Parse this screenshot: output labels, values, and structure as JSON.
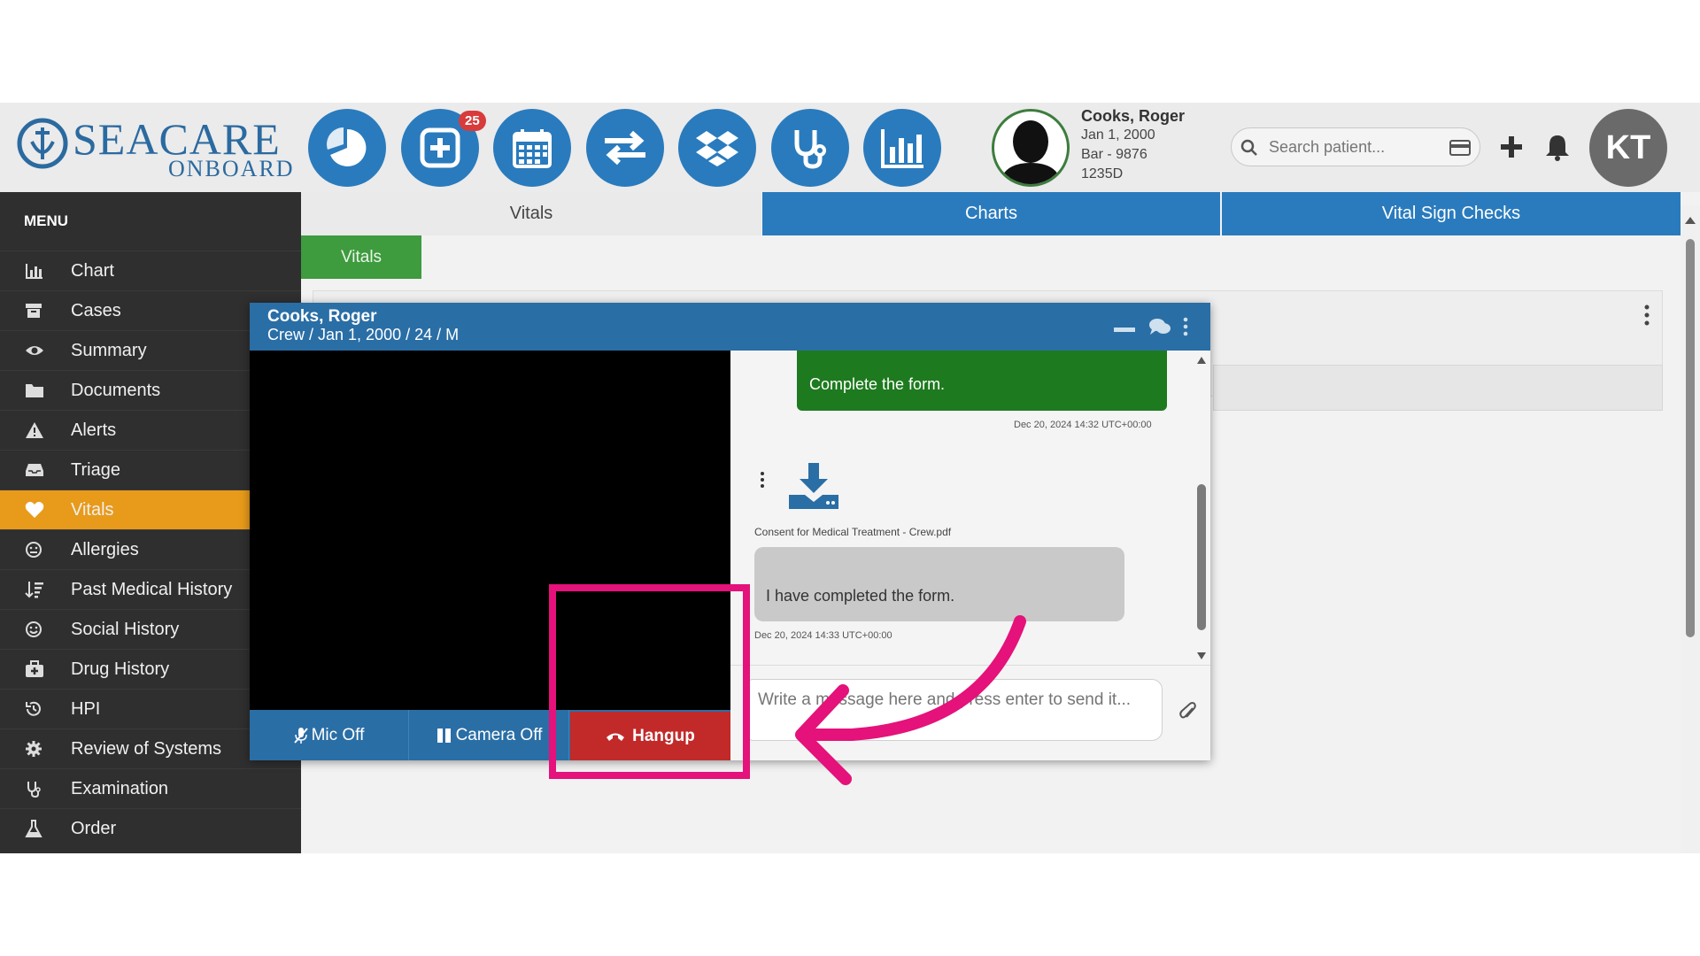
{
  "header": {
    "logo_title": "SEACARE",
    "logo_subtitle": "ONBOARD",
    "nav_icons": [
      "pie-chart-icon",
      "medical-plus-icon",
      "calendar-icon",
      "transfer-arrows-icon",
      "dropbox-icon",
      "stethoscope-icon",
      "bar-chart-icon"
    ],
    "notification_count": "25",
    "patient": {
      "name": "Cooks, Roger",
      "dob": "Jan 1, 2000",
      "vessel": "Bar - 9876",
      "id": "1235D"
    },
    "search": {
      "placeholder": "Search patient..."
    },
    "user_initials": "KT"
  },
  "sidebar": {
    "title": "MENU",
    "items": [
      {
        "label": "Chart",
        "icon": "bar-chart-icon"
      },
      {
        "label": "Cases",
        "icon": "archive-icon"
      },
      {
        "label": "Summary",
        "icon": "eye-icon"
      },
      {
        "label": "Documents",
        "icon": "folder-icon"
      },
      {
        "label": "Alerts",
        "icon": "warning-icon"
      },
      {
        "label": "Triage",
        "icon": "inbox-icon"
      },
      {
        "label": "Vitals",
        "icon": "heart-icon",
        "active": true
      },
      {
        "label": "Allergies",
        "icon": "face-icon"
      },
      {
        "label": "Past Medical History",
        "icon": "sort-icon"
      },
      {
        "label": "Social History",
        "icon": "smile-icon"
      },
      {
        "label": "Drug History",
        "icon": "medkit-icon"
      },
      {
        "label": "HPI",
        "icon": "history-icon"
      },
      {
        "label": "Review of Systems",
        "icon": "gear-icon"
      },
      {
        "label": "Examination",
        "icon": "stethoscope-icon"
      },
      {
        "label": "Order",
        "icon": "flask-icon"
      }
    ]
  },
  "tabs": [
    "Vitals",
    "Charts",
    "Vital Sign Checks"
  ],
  "subtab": "Vitals",
  "chat": {
    "patient_name": "Cooks, Roger",
    "patient_meta": "Crew / Jan 1, 2000 / 24 / M",
    "messages": {
      "outgoing_text": "Complete the form.",
      "outgoing_time": "Dec 20, 2024 14:32 UTC+00:00",
      "file_name": "Consent for Medical Treatment - Crew.pdf",
      "incoming_text": "I have completed the form.",
      "incoming_time": "Dec 20, 2024 14:33 UTC+00:00"
    },
    "compose_placeholder": "Write a message here and press enter to send it...",
    "controls": {
      "mic": "Mic Off",
      "camera": "Camera Off",
      "hangup": "Hangup"
    }
  },
  "colors": {
    "primary": "#2a7bbd",
    "active_menu": "#e89a1a",
    "sent_message": "#1e7a1e",
    "hangup": "#c22a2a",
    "annotation": "#e4127a"
  }
}
